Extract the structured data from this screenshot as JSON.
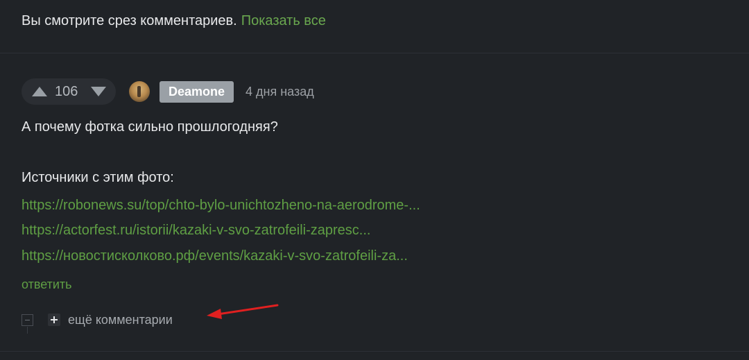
{
  "notice": {
    "text": "Вы смотрите срез комментариев.",
    "show_all": "Показать все"
  },
  "comment": {
    "rating": "106",
    "author": "Deamone",
    "time": "4 дня назад",
    "text": "А почему фотка сильно прошлогодняя?",
    "sources_heading": "Источники с этим фото:",
    "links": [
      "https://robonews.su/top/chto-bylo-unichtozheno-na-aerodrome-...",
      "https://actorfest.ru/istorii/kazaki-v-svo-zatrofeili-zapresc...",
      "https://новостисколково.рф/events/kazaki-v-svo-zatrofeili-za..."
    ],
    "reply": "ответить"
  },
  "thread": {
    "more_comments": "ещё комментарии"
  },
  "colors": {
    "background": "#202327",
    "link": "#5f9f44",
    "annotation_arrow": "#e02020"
  }
}
